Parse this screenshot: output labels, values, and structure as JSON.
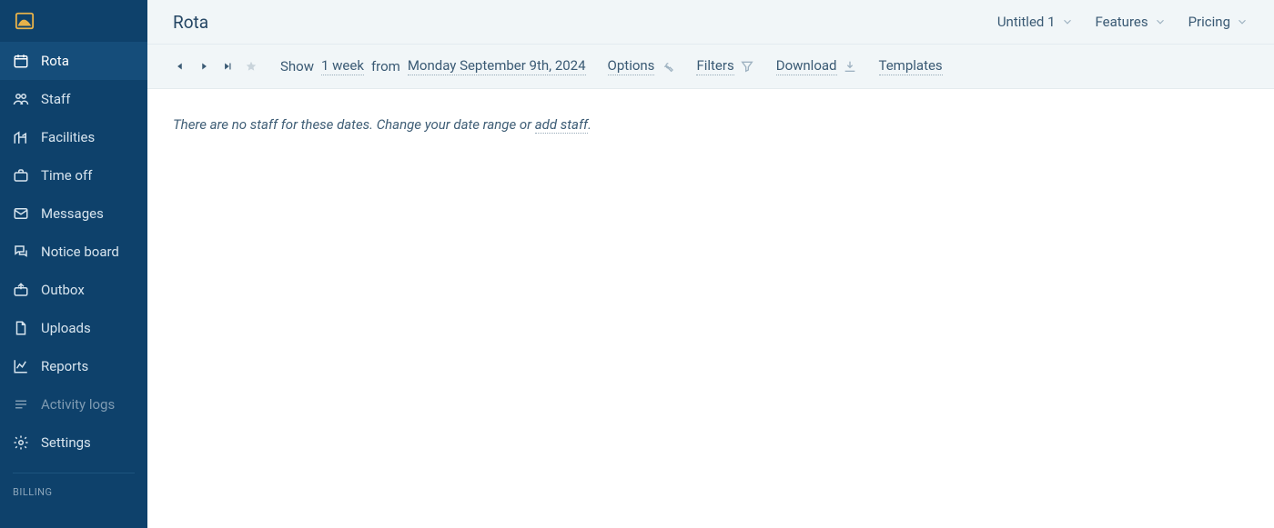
{
  "page_title": "Rota",
  "top_menus": {
    "workspace": {
      "label": "Untitled 1"
    },
    "features": {
      "label": "Features"
    },
    "pricing": {
      "label": "Pricing"
    }
  },
  "sidebar": {
    "items": [
      {
        "id": "rota",
        "label": "Rota",
        "icon": "calendar-icon",
        "active": true
      },
      {
        "id": "staff",
        "label": "Staff",
        "icon": "users-icon",
        "active": false
      },
      {
        "id": "facilities",
        "label": "Facilities",
        "icon": "facility-icon",
        "active": false
      },
      {
        "id": "timeoff",
        "label": "Time off",
        "icon": "briefcase-icon",
        "active": false
      },
      {
        "id": "messages",
        "label": "Messages",
        "icon": "envelope-icon",
        "active": false
      },
      {
        "id": "noticeboard",
        "label": "Notice board",
        "icon": "chat-icon",
        "active": false
      },
      {
        "id": "outbox",
        "label": "Outbox",
        "icon": "outbox-icon",
        "active": false
      },
      {
        "id": "uploads",
        "label": "Uploads",
        "icon": "file-icon",
        "active": false
      },
      {
        "id": "reports",
        "label": "Reports",
        "icon": "chart-icon",
        "active": false
      },
      {
        "id": "activitylogs",
        "label": "Activity logs",
        "icon": "lines-icon",
        "active": false,
        "dim": true
      },
      {
        "id": "settings",
        "label": "Settings",
        "icon": "gear-icon",
        "active": false
      }
    ],
    "billing_label": "BILLING"
  },
  "toolbar": {
    "show_label": "Show",
    "range_value": "1 week",
    "from_label": "from",
    "date_value": "Monday September 9th, 2024",
    "options_label": "Options",
    "filters_label": "Filters",
    "download_label": "Download",
    "templates_label": "Templates"
  },
  "empty_state": {
    "prefix": "There are no staff for these dates. Change your date range or ",
    "link_text": "add staff",
    "suffix": "."
  }
}
